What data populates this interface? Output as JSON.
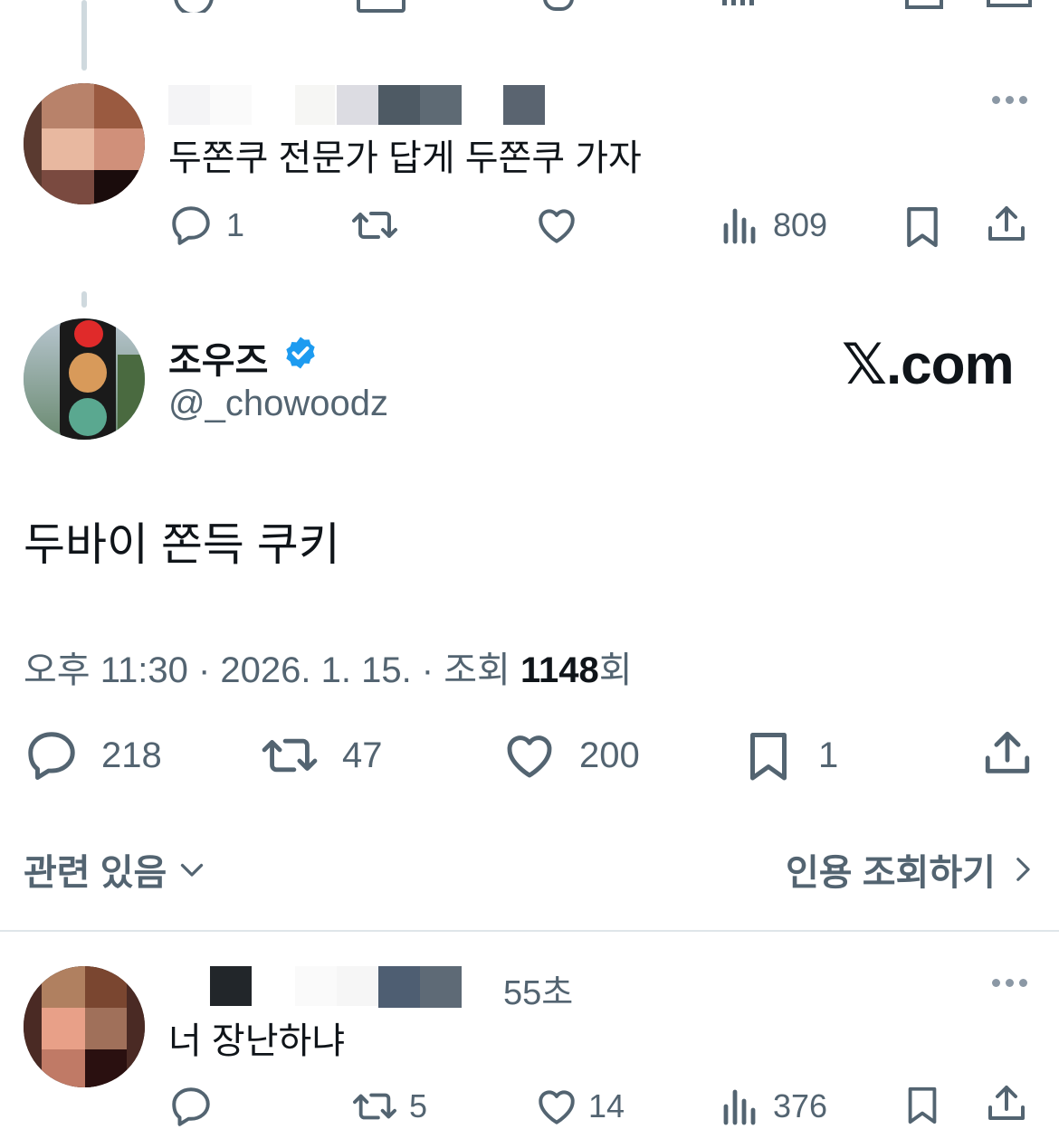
{
  "reply1": {
    "text": "두쫀쿠 전문가 답게 두쫀쿠 가자",
    "actions": {
      "replies": "1",
      "reposts": "",
      "likes": "",
      "views": "809"
    }
  },
  "main": {
    "name": "조우즈",
    "handle": "@_chowoodz",
    "brand": "𝕏.com",
    "text": "두바이 쫀득 쿠키",
    "meta_prefix": "오후 11:30 · 2026. 1. 15. · 조회 ",
    "meta_views": "1148",
    "meta_suffix": "회",
    "actions": {
      "replies": "218",
      "reposts": "47",
      "likes": "200",
      "bookmarks": "1"
    },
    "related_label": "관련 있음",
    "quotes_label": "인용 조회하기"
  },
  "reply2": {
    "time": "55초",
    "text": "너 장난하냐",
    "actions": {
      "replies": "",
      "reposts": "5",
      "likes": "14",
      "views": "376"
    }
  },
  "colors": {
    "verified": "#1d9bf0",
    "muted": "#536471",
    "text": "#0f1419"
  }
}
